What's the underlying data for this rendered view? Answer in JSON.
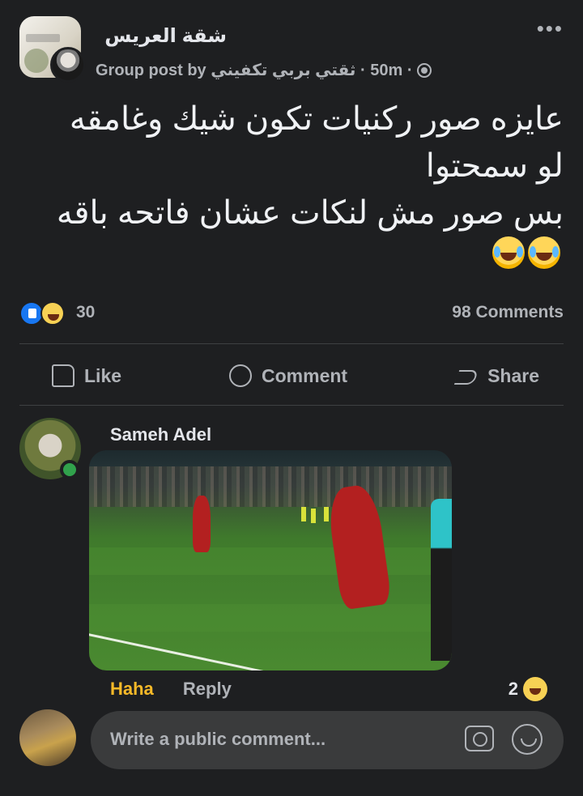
{
  "post": {
    "group_name": "شقة العريس",
    "meta_prefix": "Group post by",
    "author": "ثقتي بربي تكفيني",
    "time": "· 50m ·",
    "text_line_1": "عايزه صور ركنيات تكون شيك وغامقه",
    "text_line_2": "لو سمحتوا",
    "text_line_3": "بس صور مش لنكات عشان فاتحه باقه",
    "reaction_icons": [
      "like-icon",
      "haha-icon"
    ],
    "reaction_count": "30",
    "comments_count": "98 Comments"
  },
  "actions": {
    "like": "Like",
    "comment": "Comment",
    "share": "Share"
  },
  "comment": {
    "author": "Sameh Adel",
    "reaction_label": "Haha",
    "reply_label": "Reply",
    "reaction_count": "2"
  },
  "composer": {
    "placeholder": "Write a public comment..."
  },
  "colors": {
    "background": "#1e1f21",
    "accent_blue": "#1877f2",
    "haha_yellow": "#f7b928",
    "online_green": "#31a24c"
  }
}
